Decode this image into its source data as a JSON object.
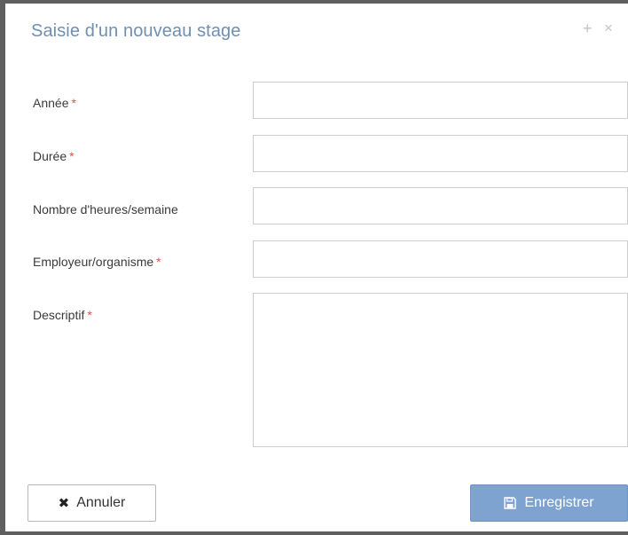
{
  "dialog": {
    "title": "Saisie d'un nouveau stage",
    "expand_glyph": "+",
    "close_glyph": "×"
  },
  "form": {
    "required_marker": "*",
    "fields": [
      {
        "label": "Année",
        "required": true,
        "value": ""
      },
      {
        "label": "Durée",
        "required": true,
        "value": ""
      },
      {
        "label": "Nombre d'heures/semaine",
        "required": false,
        "value": ""
      },
      {
        "label": "Employeur/organisme",
        "required": true,
        "value": ""
      },
      {
        "label": "Descriptif",
        "required": true,
        "value": ""
      }
    ]
  },
  "footer": {
    "cancel_label": "Annuler",
    "cancel_icon": "times-icon",
    "save_label": "Enregistrer",
    "save_icon": "floppy-disk-icon"
  },
  "colors": {
    "title": "#6f8fb3",
    "required": "#d9534f",
    "primary_button": "#7fa3d1"
  }
}
